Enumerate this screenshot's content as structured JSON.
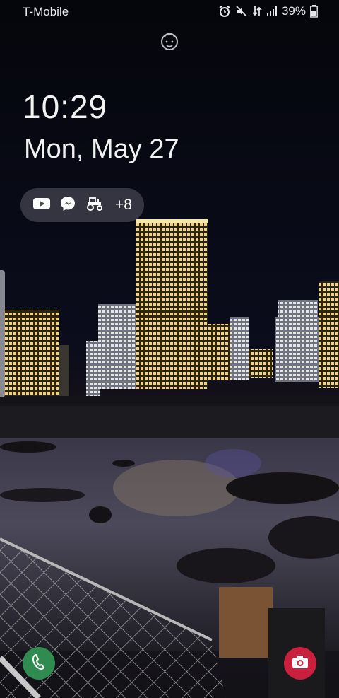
{
  "status_bar": {
    "carrier": "T-Mobile",
    "battery_percent": "39%",
    "icons": [
      "alarm-icon",
      "mute-icon",
      "data-transfer-icon",
      "signal-icon",
      "battery-icon"
    ]
  },
  "lock_screen": {
    "time": "10:29",
    "date": "Mon, May 27",
    "notifications": {
      "icons": [
        "youtube-icon",
        "messenger-icon",
        "tractor-icon"
      ],
      "more_count": "+8"
    }
  },
  "shortcuts": {
    "left": "phone-icon",
    "right": "camera-icon"
  },
  "colors": {
    "phone_shortcut": "#2f8b4f",
    "camera_shortcut": "#c8203d",
    "text": "#f2f2f2"
  }
}
